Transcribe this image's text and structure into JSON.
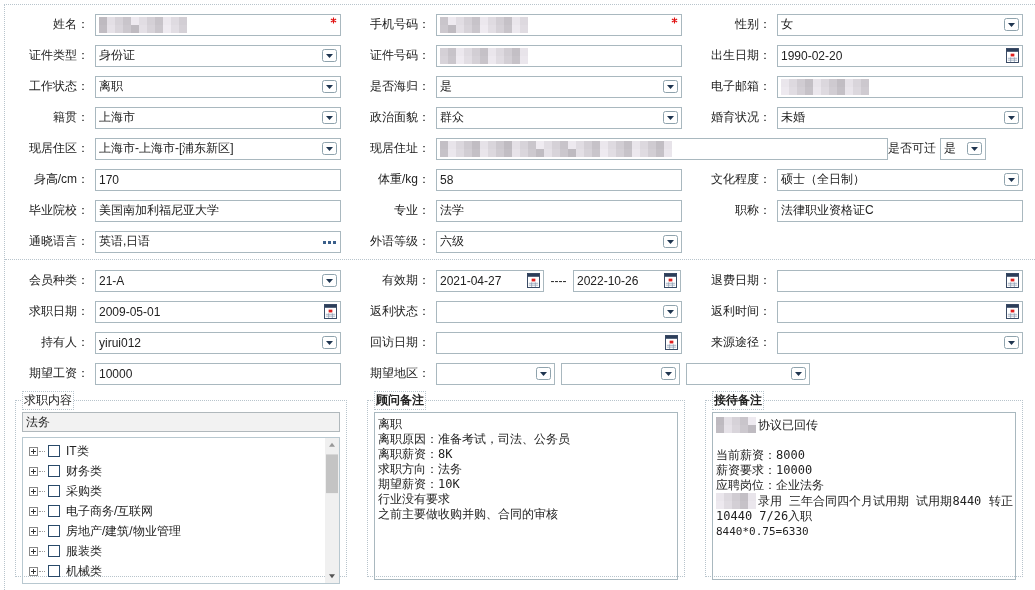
{
  "sections": [
    {
      "rows": [
        {
          "fields": [
            {
              "label": "姓名：",
              "kind": "text",
              "redacted": true,
              "required": true
            },
            {
              "label": "手机号码：",
              "kind": "text",
              "redacted": true,
              "required": true
            },
            {
              "label": "性别：",
              "kind": "select",
              "value": "女"
            }
          ]
        },
        {
          "fields": [
            {
              "label": "证件类型：",
              "kind": "select",
              "value": "身份证"
            },
            {
              "label": "证件号码：",
              "kind": "text",
              "redacted": true
            },
            {
              "label": "出生日期：",
              "kind": "date",
              "value": "1990-02-20"
            }
          ]
        },
        {
          "fields": [
            {
              "label": "工作状态：",
              "kind": "select",
              "value": "离职"
            },
            {
              "label": "是否海归：",
              "kind": "select",
              "value": "是"
            },
            {
              "label": "电子邮箱：",
              "kind": "text",
              "redacted": true
            }
          ]
        },
        {
          "fields": [
            {
              "label": "籍贯：",
              "kind": "select",
              "value": "上海市"
            },
            {
              "label": "政治面貌：",
              "kind": "select",
              "value": "群众"
            },
            {
              "label": "婚育状况：",
              "kind": "select",
              "value": "未婚"
            }
          ]
        },
        {
          "fields": [
            {
              "label": "现居住区：",
              "kind": "select",
              "value": "上海市-上海市-[浦东新区]"
            },
            {
              "label": "现居住址：",
              "kind": "wide",
              "redacted": true
            },
            {
              "label": "是否可迁",
              "kind": "mini-select",
              "value": "是"
            }
          ]
        },
        {
          "fields": [
            {
              "label": "身高/cm：",
              "kind": "text",
              "value": "170"
            },
            {
              "label": "体重/kg：",
              "kind": "text",
              "value": "58"
            },
            {
              "label": "文化程度：",
              "kind": "select",
              "value": "硕士（全日制）"
            }
          ]
        },
        {
          "fields": [
            {
              "label": "毕业院校：",
              "kind": "text",
              "value": "美国南加利福尼亚大学"
            },
            {
              "label": "专业：",
              "kind": "text",
              "value": "法学"
            },
            {
              "label": "职称：",
              "kind": "text",
              "value": "法律职业资格证C"
            }
          ]
        },
        {
          "fields": [
            {
              "label": "通晓语言：",
              "kind": "more",
              "value": "英语,日语"
            },
            {
              "label": "外语等级：",
              "kind": "select",
              "value": "六级"
            }
          ]
        }
      ]
    },
    {
      "rows": [
        {
          "fields": [
            {
              "label": "会员种类：",
              "kind": "select",
              "value": "21-A"
            },
            {
              "label": "有效期：",
              "kind": "date-range",
              "values": [
                "2021-04-27",
                "2022-10-26"
              ],
              "separator": "----"
            },
            {
              "label": "退费日期：",
              "kind": "date"
            }
          ]
        },
        {
          "fields": [
            {
              "label": "求职日期：",
              "kind": "date",
              "value": "2009-05-01"
            },
            {
              "label": "返利状态：",
              "kind": "select"
            },
            {
              "label": "返利时间：",
              "kind": "date"
            }
          ]
        },
        {
          "fields": [
            {
              "label": "持有人：",
              "kind": "select",
              "value": "yirui012"
            },
            {
              "label": "回访日期：",
              "kind": "date"
            },
            {
              "label": "来源途径：",
              "kind": "select"
            }
          ]
        },
        {
          "fields": [
            {
              "label": "期望工资：",
              "kind": "text",
              "value": "10000"
            },
            {
              "label": "期望地区：",
              "kind": "multi-select",
              "boxes": [
                {
                  "kind": "select"
                },
                {
                  "kind": "select"
                },
                {
                  "kind": "select"
                }
              ]
            }
          ]
        }
      ]
    }
  ],
  "panels": [
    {
      "kind": "tree",
      "title": "求职内容",
      "search_value": "法务",
      "items": [
        {
          "label": "IT类",
          "checked": false,
          "expanded": false
        },
        {
          "label": "财务类",
          "checked": false,
          "expanded": false
        },
        {
          "label": "采购类",
          "checked": false,
          "expanded": false
        },
        {
          "label": "电子商务/互联网",
          "checked": false,
          "expanded": false
        },
        {
          "label": "房地产/建筑/物业管理",
          "checked": false,
          "expanded": false
        },
        {
          "label": "服装类",
          "checked": false,
          "expanded": false
        },
        {
          "label": "机械类",
          "checked": false,
          "expanded": false
        }
      ]
    },
    {
      "kind": "notes",
      "title": "顾问备注",
      "lines": [
        {
          "text": "离职"
        },
        {
          "text": "离职原因：准备考试，司法、公务员"
        },
        {
          "text": "离职薪资：8K"
        },
        {
          "text": "求职方向：法务"
        },
        {
          "text": "期望薪资：10K"
        },
        {
          "text": "行业没有要求"
        },
        {
          "text": "之前主要做收购并购、合同的审核"
        }
      ]
    },
    {
      "kind": "notes",
      "title": "接待备注",
      "lines": [
        {
          "text": "协议已回传",
          "redacted_prefix": true
        },
        {
          "text": "当前薪资：8000",
          "gap_before": true
        },
        {
          "text": "薪资要求：10000"
        },
        {
          "text": "应聘岗位：企业法务"
        },
        {
          "text": "录用  三年合同四个月试用期 试用期8440 转正",
          "redacted_prefix": true
        },
        {
          "text": "10440  7/26入职"
        },
        {
          "text": "8440*0.75=6330"
        }
      ]
    }
  ]
}
